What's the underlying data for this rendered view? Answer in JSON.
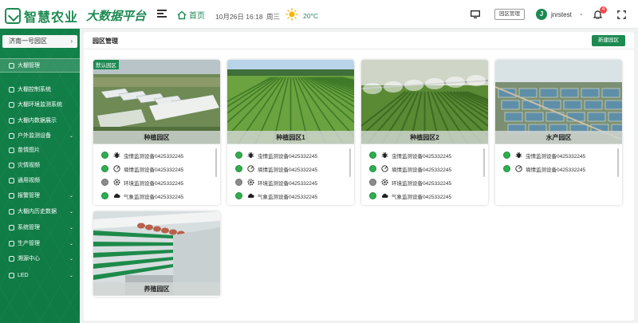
{
  "app": {
    "brand": "智慧农业",
    "platform": "大数据平台"
  },
  "header": {
    "home_label": "首页",
    "datetime": "10月26日 16:18",
    "weekday": "周三",
    "temperature": "20°C",
    "park_mgmt_button": "园区管理",
    "user_initial": "J",
    "username": "jnrstest",
    "notification_count": "4"
  },
  "sidebar": {
    "park_select": "济南一号园区",
    "items": [
      {
        "label": "大棚管理",
        "caret": ""
      },
      {
        "label": "大棚控制系统",
        "caret": ""
      },
      {
        "label": "大棚环境监测系统",
        "caret": ""
      },
      {
        "label": "大棚内数据展示",
        "caret": ""
      },
      {
        "label": "户外监测设备",
        "caret": "⌄"
      },
      {
        "label": "苗情图片",
        "caret": ""
      },
      {
        "label": "灾情视频",
        "caret": ""
      },
      {
        "label": "通用视频",
        "caret": ""
      },
      {
        "label": "报警管理",
        "caret": "⌄"
      },
      {
        "label": "大棚内历史数据",
        "caret": "⌄"
      },
      {
        "label": "系统管理",
        "caret": "⌄"
      },
      {
        "label": "生产管理",
        "caret": "⌄"
      },
      {
        "label": "溯源中心",
        "caret": "⌄"
      },
      {
        "label": "LED",
        "caret": "⌄"
      }
    ]
  },
  "main": {
    "title": "园区管理",
    "new_button": "新建园区",
    "default_tag": "默认园区",
    "cards": [
      {
        "name": "种植园区",
        "scene": "greenhouse",
        "devices": [
          {
            "label": "虫情监测设备0425332245",
            "status": "online",
            "icon": "bug-icon"
          },
          {
            "label": "墒情监测设备0425332245",
            "status": "online",
            "icon": "gauge-icon"
          },
          {
            "label": "环境监测设备0425332245",
            "status": "offline",
            "icon": "settings-icon"
          },
          {
            "label": "气象监测设备0425332245",
            "status": "online",
            "icon": "cloud-icon"
          }
        ]
      },
      {
        "name": "种植园区1",
        "scene": "field",
        "devices": [
          {
            "label": "虫情监测设备0425332245",
            "status": "online",
            "icon": "bug-icon"
          },
          {
            "label": "墒情监测设备0425332245",
            "status": "online",
            "icon": "gauge-icon"
          },
          {
            "label": "环境监测设备0425332245",
            "status": "offline",
            "icon": "settings-icon"
          },
          {
            "label": "气象监测设备0425332245",
            "status": "online",
            "icon": "cloud-icon"
          }
        ]
      },
      {
        "name": "种植园区2",
        "scene": "irrigation",
        "devices": [
          {
            "label": "虫情监测设备0425332245",
            "status": "online",
            "icon": "bug-icon"
          },
          {
            "label": "墒情监测设备0425332245",
            "status": "online",
            "icon": "gauge-icon"
          },
          {
            "label": "环境监测设备0425332245",
            "status": "offline",
            "icon": "settings-icon"
          },
          {
            "label": "气象监测设备0425332245",
            "status": "online",
            "icon": "cloud-icon"
          }
        ]
      },
      {
        "name": "水产园区",
        "scene": "aqua",
        "devices": [
          {
            "label": "虫情监测设备0425332245",
            "status": "online",
            "icon": "bug-icon"
          },
          {
            "label": "墒情监测设备0425332245",
            "status": "online",
            "icon": "gauge-icon"
          }
        ]
      },
      {
        "name": "养殖园区",
        "scene": "poultry",
        "devices": []
      }
    ]
  },
  "colors": {
    "brand_green": "#1d8a52",
    "online": "#2fae4f",
    "offline": "#8c8c8c",
    "badge": "#f04a4a"
  }
}
